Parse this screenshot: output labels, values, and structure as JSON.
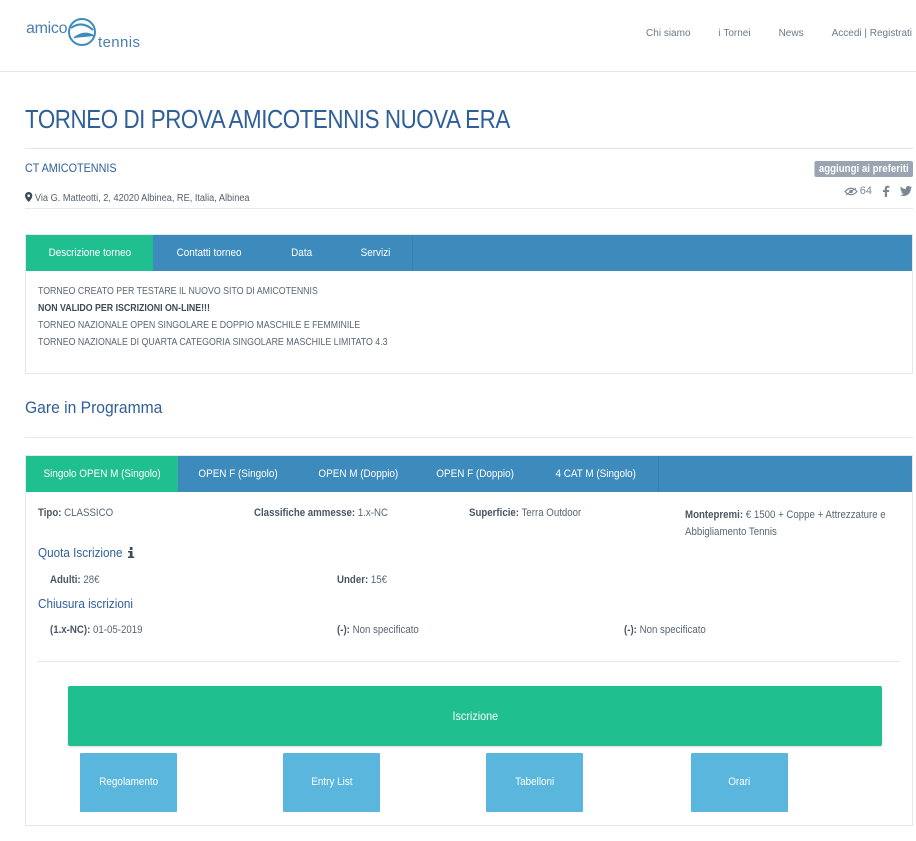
{
  "header": {
    "logo_part1": "amico",
    "logo_part2": "tennis",
    "nav": [
      "Chi siamo",
      "i Tornei",
      "News",
      "Accedi | Registrati"
    ]
  },
  "tournament": {
    "title": "TORNEO DI PROVA AMICOTENNIS NUOVA ERA",
    "club": "CT AMICOTENNIS",
    "favorite_label": "aggiungi ai preferiti",
    "address": "Via G. Matteotti, 2, 42020 Albinea, RE, Italia, Albinea",
    "views": "64"
  },
  "info_tabs": [
    "Descrizione torneo",
    "Contatti torneo",
    "Data",
    "Servizi"
  ],
  "description": [
    "TORNEO CREATO PER TESTARE IL NUOVO SITO DI AMICOTENNIS",
    "NON VALIDO PER ISCRIZIONI ON-LINE!!!",
    "TORNEO NAZIONALE OPEN SINGOLARE E DOPPIO MASCHILE E FEMMINILE",
    "TORNEO NAZIONALE DI QUARTA CATEGORIA SINGOLARE MASCHILE LIMITATO 4.3"
  ],
  "gare": {
    "section_title": "Gare in Programma",
    "tabs": [
      "Singolo OPEN M (Singolo)",
      "OPEN F (Singolo)",
      "OPEN M (Doppio)",
      "OPEN F (Doppio)",
      "4 CAT M (Singolo)"
    ],
    "tipo_label": "Tipo:",
    "tipo_value": "CLASSICO",
    "classifiche_label": "Classifiche ammesse:",
    "classifiche_value": "1.x-NC",
    "superficie_label": "Superficie:",
    "superficie_value": "Terra Outdoor",
    "montepremi_label": "Montepremi:",
    "montepremi_value_line1": "€ 1500 + Coppe + Attrezzature e",
    "montepremi_value_line2": "Abbigliamento Tennis",
    "quota_title": "Quota Iscrizione",
    "adulti_label": "Adulti:",
    "adulti_value": "28€",
    "under_label": "Under:",
    "under_value": "15€",
    "chiusura_title": "Chiusura iscrizioni",
    "chiusure": [
      {
        "label": "(1.x-NC):",
        "value": "01-05-2019"
      },
      {
        "label": "(-):",
        "value": "Non specificato"
      },
      {
        "label": "(-):",
        "value": "Non specificato"
      }
    ],
    "iscrizione_button": "Iscrizione",
    "buttons": [
      "Regolamento",
      "Entry List",
      "Tabelloni",
      "Orari"
    ]
  },
  "colors": {
    "primary_blue": "#3d8bbd",
    "active_green": "#1fbf8f",
    "light_blue_button": "#5ab6dc",
    "title_blue": "#2f5f9a"
  }
}
